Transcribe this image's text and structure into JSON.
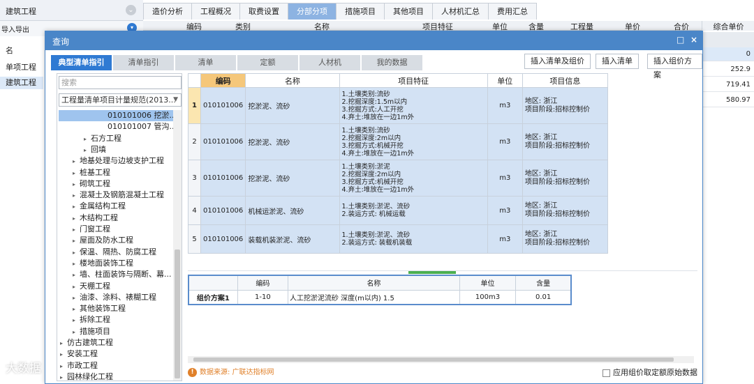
{
  "background": {
    "tree_title": "建筑工程",
    "toolbar_label": "导入导出",
    "top_tabs": [
      "造价分析",
      "工程概况",
      "取费设置",
      "分部分项",
      "措施项目",
      "其他项目",
      "人材机汇总",
      "费用汇总"
    ],
    "active_top_tab": "分部分项",
    "grid_headers": [
      "编码",
      "类别",
      "名称",
      "项目特征",
      "单位",
      "含量",
      "工程量",
      "单价",
      "合价"
    ],
    "left_list": [
      "名",
      "单项工程",
      "建筑工程"
    ],
    "right_header": "综合单价",
    "right_values": [
      "0",
      "252.9",
      "719.41",
      "580.97"
    ]
  },
  "dialog": {
    "title": "查询",
    "tabs": [
      "典型清单指引",
      "清单指引",
      "清单",
      "定额",
      "人材机",
      "我的数据"
    ],
    "active_tab": "典型清单指引",
    "buttons": [
      "插入清单及组价",
      "插入清单",
      "插入组价方案"
    ],
    "search_placeholder": "搜索",
    "standard_select": "工程量清单项目计量规范(2013...",
    "tree": [
      {
        "label": "010101006 挖淤...",
        "level": 4,
        "selected": true
      },
      {
        "label": "010101007 管沟...",
        "level": 4
      },
      {
        "label": "石方工程",
        "level": 3
      },
      {
        "label": "回填",
        "level": 3
      },
      {
        "label": "地基处理与边坡支护工程",
        "level": 2
      },
      {
        "label": "桩基工程",
        "level": 2
      },
      {
        "label": "砌筑工程",
        "level": 2
      },
      {
        "label": "混凝土及钢筋混凝土工程",
        "level": 2
      },
      {
        "label": "金属结构工程",
        "level": 2
      },
      {
        "label": "木结构工程",
        "level": 2
      },
      {
        "label": "门窗工程",
        "level": 2
      },
      {
        "label": "屋面及防水工程",
        "level": 2
      },
      {
        "label": "保温、隔热、防腐工程",
        "level": 2
      },
      {
        "label": "楼地面装饰工程",
        "level": 2
      },
      {
        "label": "墙、柱面装饰与隔断、幕...",
        "level": 2
      },
      {
        "label": "天棚工程",
        "level": 2
      },
      {
        "label": "油漆、涂料、裱糊工程",
        "level": 2
      },
      {
        "label": "其他装饰工程",
        "level": 2
      },
      {
        "label": "拆除工程",
        "level": 2
      },
      {
        "label": "措施项目",
        "level": 2
      },
      {
        "label": "仿古建筑工程",
        "level": 1
      },
      {
        "label": "安装工程",
        "level": 1
      },
      {
        "label": "市政工程",
        "level": 1
      },
      {
        "label": "园林绿化工程",
        "level": 1
      }
    ],
    "results": {
      "headers": [
        "编码",
        "名称",
        "项目特征",
        "单位",
        "项目信息"
      ],
      "rows": [
        {
          "n": "1",
          "code": "010101006",
          "name": "挖淤泥、流砂",
          "features": [
            "1.土壤类别:流砂",
            "2.挖掘深度:1.5m以内",
            "3.挖掘方式:人工开挖",
            "4.弃土:堆放在一边1m外"
          ],
          "unit": "m3",
          "info": [
            "地区: 浙江",
            "项目阶段:招标控制价"
          ]
        },
        {
          "n": "2",
          "code": "010101006",
          "name": "挖淤泥、流砂",
          "features": [
            "1.土壤类别:流砂",
            "2.挖掘深度:2m以内",
            "3.挖掘方式:机械开挖",
            "4.弃土:堆放在一边1m外"
          ],
          "unit": "m3",
          "info": [
            "地区: 浙江",
            "项目阶段:招标控制价"
          ]
        },
        {
          "n": "3",
          "code": "010101006",
          "name": "挖淤泥、流砂",
          "features": [
            "1.土壤类别:淤泥",
            "2.挖掘深度:2m以内",
            "3.挖掘方式:机械开挖",
            "4.弃土:堆放在一边1m外"
          ],
          "unit": "m3",
          "info": [
            "地区: 浙江",
            "项目阶段:招标控制价"
          ]
        },
        {
          "n": "4",
          "code": "010101006",
          "name": "机械运淤泥、流砂",
          "features": [
            "1.土壤类别:淤泥、流砂",
            "2.装运方式: 机械运载"
          ],
          "unit": "m3",
          "info": [
            "地区: 浙江",
            "项目阶段:招标控制价"
          ]
        },
        {
          "n": "5",
          "code": "010101006",
          "name": "装载机装淤泥、流砂",
          "features": [
            "1.土壤类别:淤泥、流砂",
            "2.装运方式: 装载机装载"
          ],
          "unit": "m3",
          "info": [
            "地区: 浙江",
            "项目阶段:招标控制价"
          ]
        }
      ]
    },
    "combo": {
      "headers": [
        "",
        "编码",
        "名称",
        "单位",
        "含量"
      ],
      "rows": [
        {
          "plan": "组价方案1",
          "code": "1-10",
          "name": "人工挖淤泥流砂 深度(m以内) 1.5",
          "unit": "100m3",
          "qty": "0.01"
        }
      ]
    },
    "footer_source": "数据来源: 广联达指标网",
    "footer_checkbox": "应用组价取定额原始数据",
    "close_icon": "×",
    "max_icon": "□"
  },
  "watermark": "大数据"
}
